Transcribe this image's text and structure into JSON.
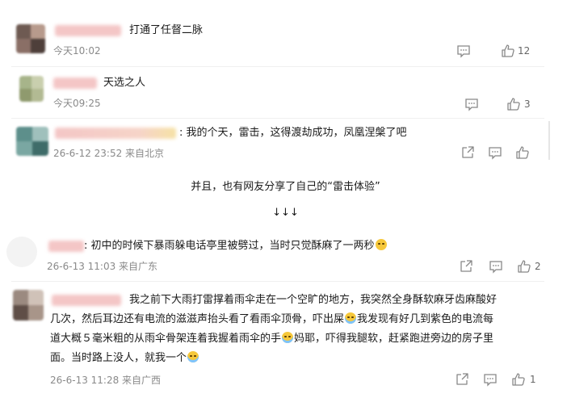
{
  "comments": [
    {
      "text": "打通了任督二脉",
      "meta": "今天10:02",
      "like_count": "12"
    },
    {
      "text": "天选之人",
      "meta": "今天09:25",
      "like_count": "3"
    },
    {
      "text": "我的个天，雷击，这得渡劫成功，凤凰涅槃了吧",
      "meta": "26-6-12 23:52 来自北京",
      "like_count": ""
    },
    {
      "text": "初中的时候下暴雨躲电话亭里被劈过，当时只觉酥麻了一两秒",
      "meta": "26-6-13 11:03 来自广东",
      "like_count": "2"
    },
    {
      "line1": "我之前下大雨打雷撑着雨伞走在一个空旷的地方，我突然全身酥软麻牙齿麻酸好",
      "line2": "几次，然后耳边还有电流的滋滋声抬头看了看雨伞顶骨，吓出屎",
      "line2b": "我发现有好几到紫色的电流每",
      "line3": "道大概５毫米粗的从雨伞骨架连着我握着雨伞的手",
      "line3b": "妈耶，吓得我腿软，赶紧跑进旁边的房子里",
      "line4": "面。当时路上没人，就我一个",
      "meta": "26-6-13 11:28 来自广西",
      "like_count": "1"
    }
  ],
  "divider_text": "并且，也有网友分享了自己的“雷击体验”",
  "arrows_text": "↓↓↓",
  "colors": {
    "meta_gray": "#8a8a8a",
    "text": "#1a1a1a",
    "icon_gray": "#888888"
  }
}
